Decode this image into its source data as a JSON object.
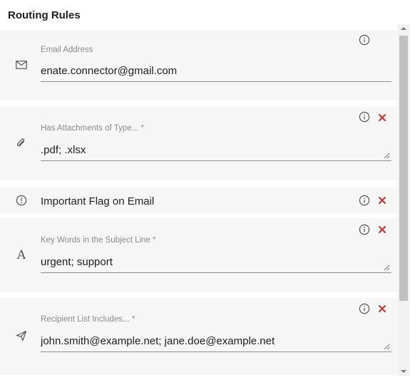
{
  "header": {
    "title": "Routing Rules"
  },
  "rules": [
    {
      "type": "email-address",
      "icon": "envelope-icon",
      "label": "Email Address",
      "value": "enate.connector@gmail.com",
      "removable": false
    },
    {
      "type": "attachments",
      "icon": "paperclip-icon",
      "label": "Has Attachments of Type... *",
      "value": ".pdf; .xlsx",
      "removable": true
    },
    {
      "type": "important-flag",
      "icon": "alert-circle-icon",
      "label": "Important Flag on Email",
      "removable": true
    },
    {
      "type": "subject-keywords",
      "icon": "font-letter-icon",
      "icon_glyph": "A",
      "label": "Key Words in the Subject Line *",
      "value": "urgent; support",
      "removable": true
    },
    {
      "type": "recipient-list",
      "icon": "send-icon",
      "label": "Recipient List Includes... *",
      "value": "john.smith@example.net; jane.doe@example.net",
      "removable": true
    }
  ],
  "colors": {
    "row_background": "#f6f6f6",
    "remove_icon": "#d32f2f",
    "text": "#212121",
    "label": "#8a8a8a"
  }
}
